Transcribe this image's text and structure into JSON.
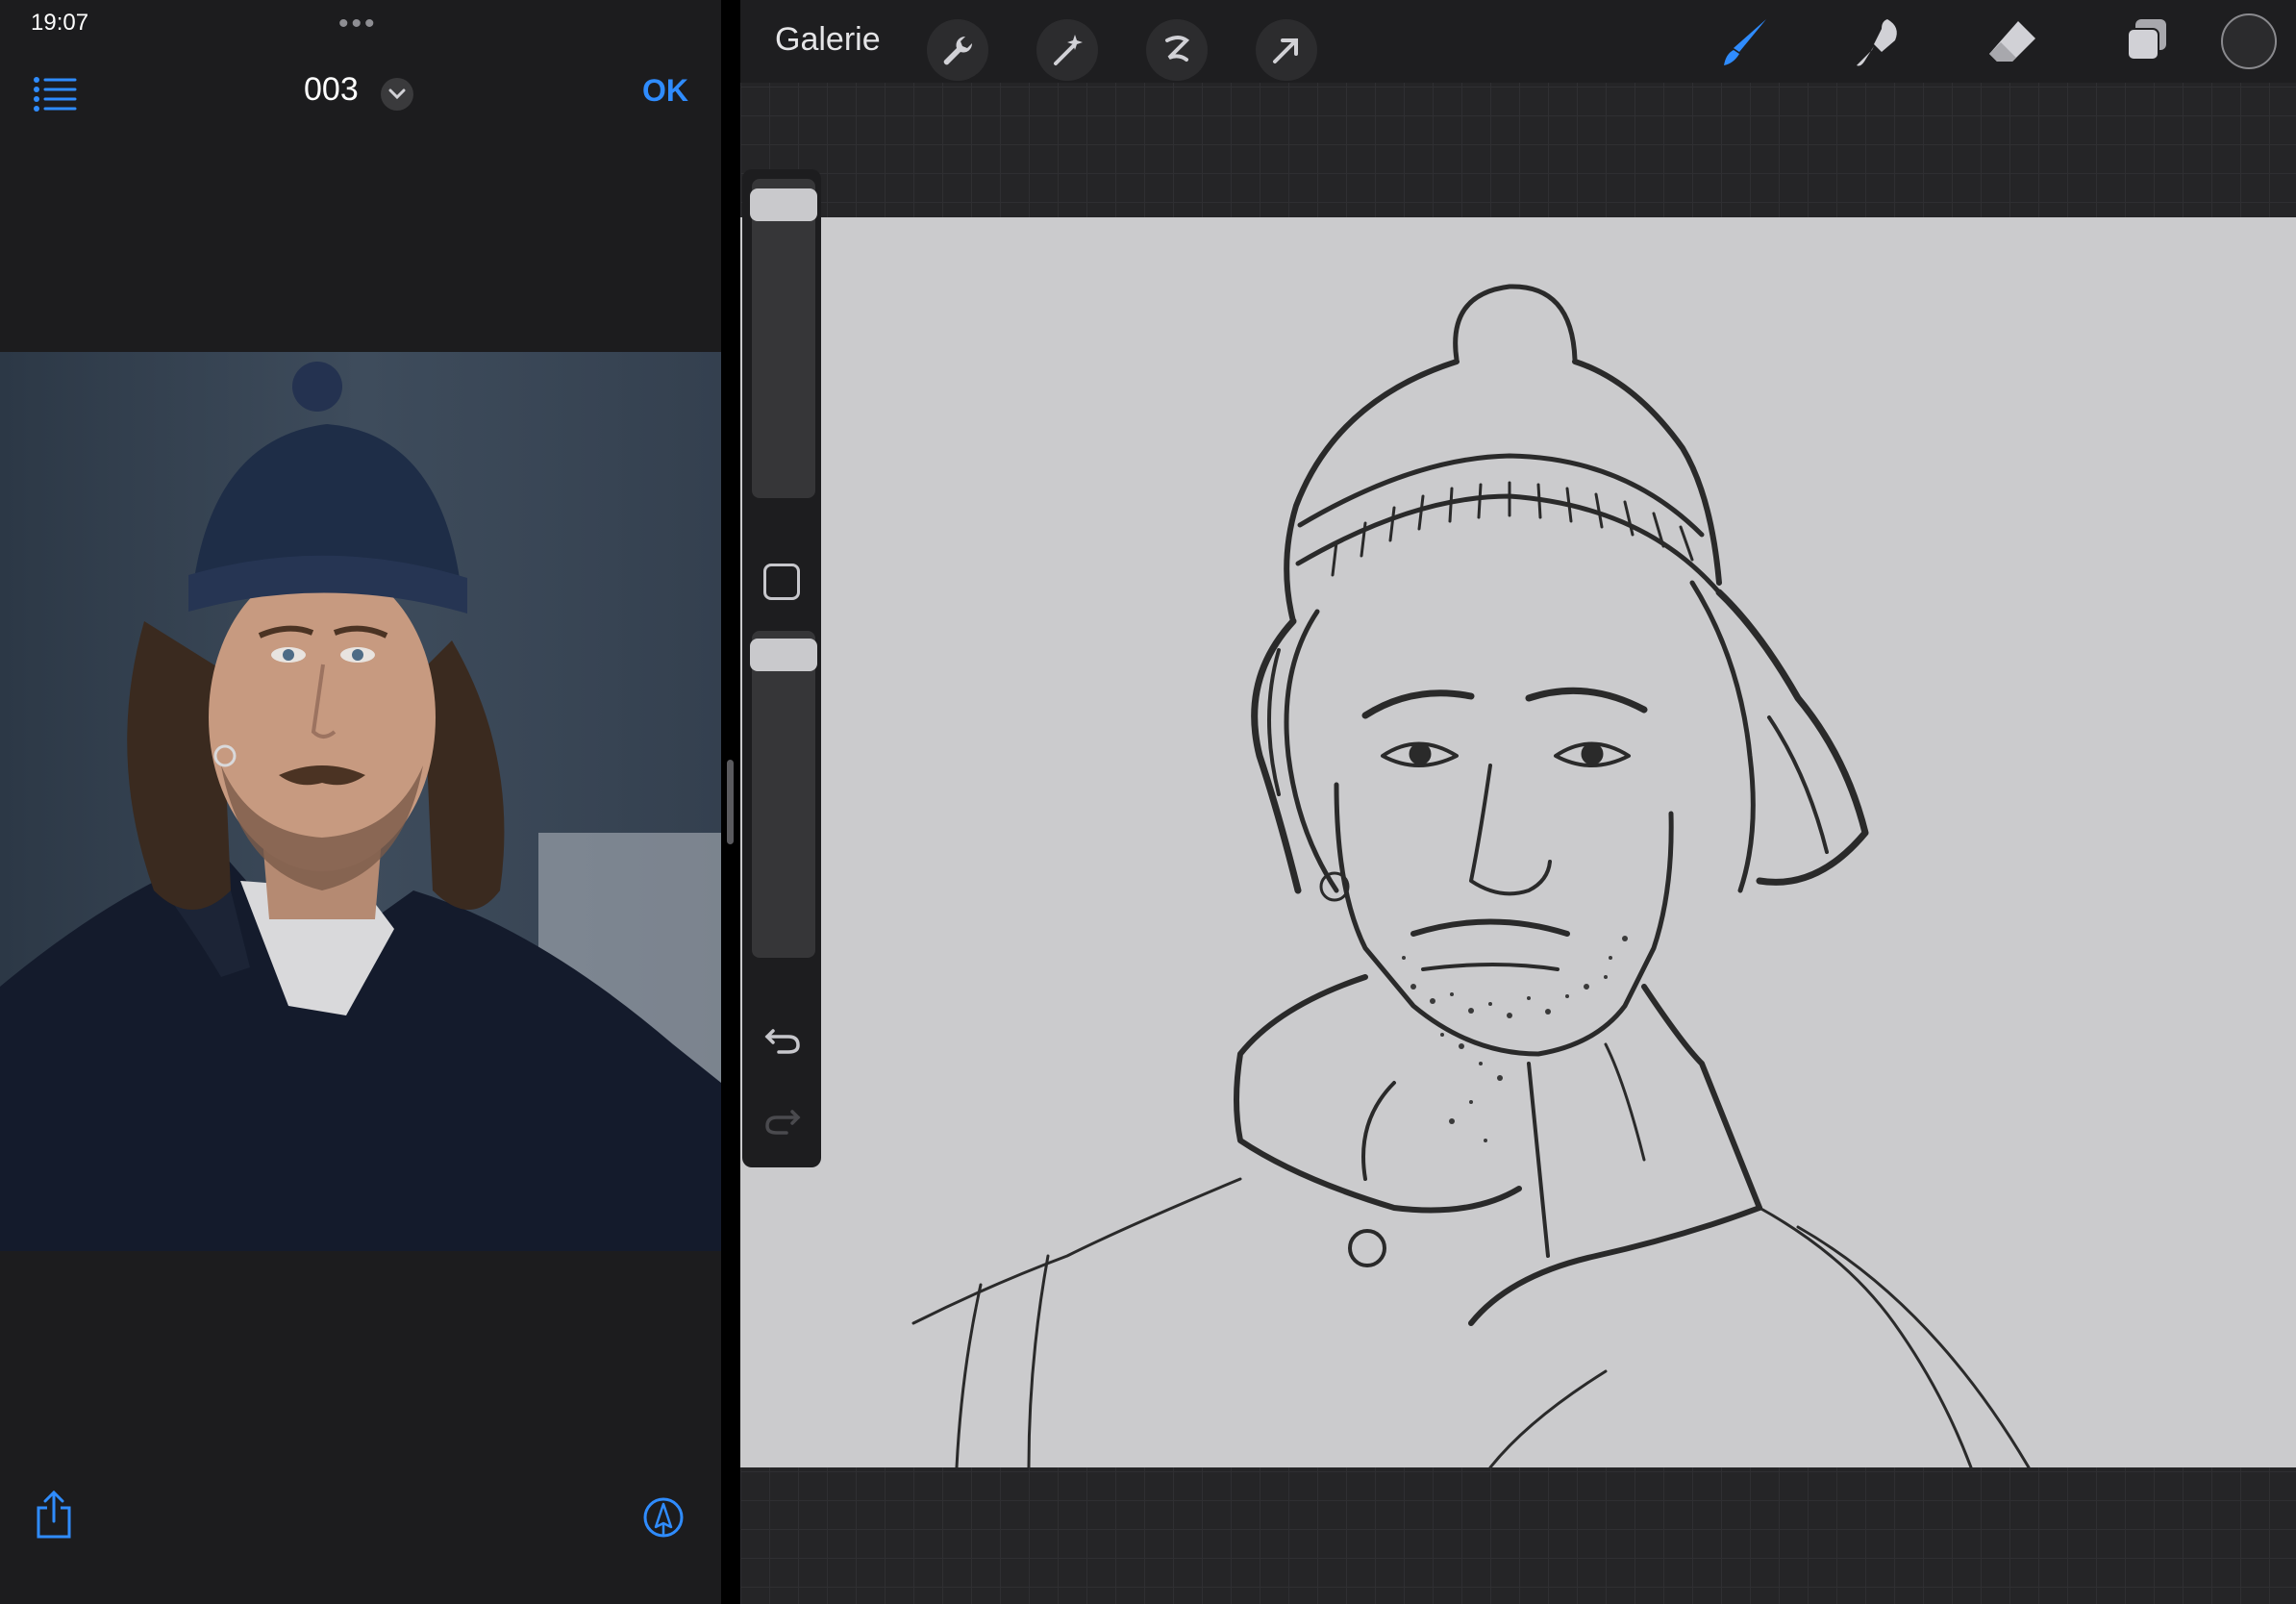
{
  "status_bar": {
    "time": "19:07"
  },
  "files_app": {
    "document_title": "003",
    "done_label": "OK",
    "accent_color": "#2f8cff",
    "icons": [
      "list-icon",
      "chevron-down-icon",
      "share-icon",
      "markup-icon"
    ]
  },
  "procreate": {
    "gallery_label": "Galerie",
    "toolbar_left_icons": [
      "wrench-icon",
      "magic-wand-icon",
      "selection-icon",
      "transform-arrow-icon"
    ],
    "toolbar_right_icons": [
      "brush-icon",
      "smudge-icon",
      "eraser-icon",
      "layers-icon"
    ],
    "active_tool": "brush",
    "active_tool_color": "#2f8cff",
    "current_color": "#2b2b2d",
    "brush_size_level": 0.95,
    "opacity_level": 0.95,
    "canvas_background": "#cbcbcd"
  }
}
